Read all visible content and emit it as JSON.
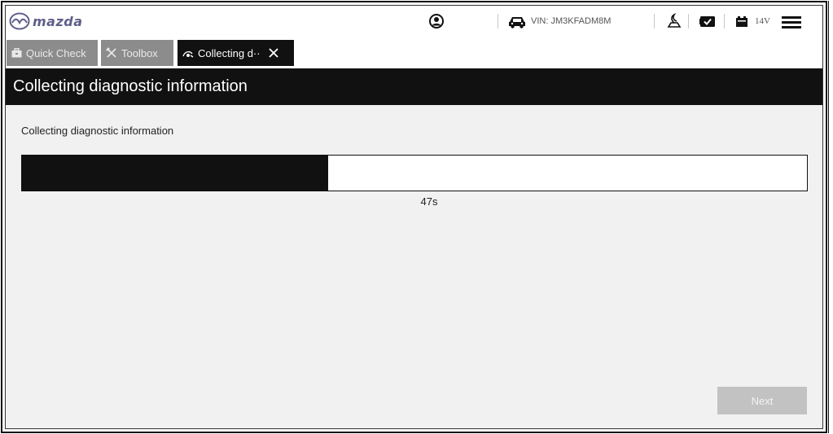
{
  "header": {
    "logo_text": "mazda",
    "vin_text": "VIN: JM3KFADM8M",
    "voltage_text": "14V",
    "icons": [
      "mazda-logo-icon",
      "user-icon",
      "car-icon",
      "sleep-mode-icon",
      "ecu-connection-icon",
      "battery-icon",
      "menu-icon"
    ]
  },
  "tabs": [
    {
      "label": "Quick Check",
      "icon": "briefcase-icon",
      "active": false
    },
    {
      "label": "Toolbox",
      "icon": "tools-icon",
      "active": false
    },
    {
      "label": "Collecting d··",
      "icon": "collect-icon",
      "active": true
    }
  ],
  "page": {
    "title": "Collecting diagnostic information",
    "subtitle": "Collecting diagnostic information",
    "progress_fraction": 0.39,
    "time_remaining": "47s",
    "next_label": "Next"
  },
  "colors": {
    "band": "#111111",
    "tab_inactive": "#8c8c8c",
    "button_disabled": "#c2c2c2",
    "background": "#f1f1f1"
  }
}
